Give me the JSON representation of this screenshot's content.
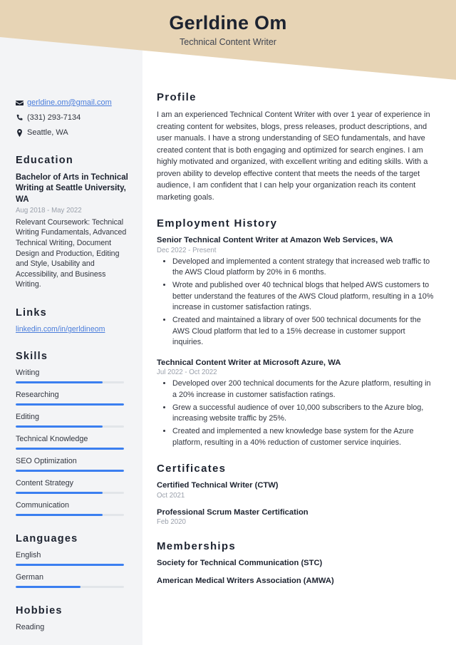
{
  "header": {
    "name": "Gerldine Om",
    "subtitle": "Technical Content Writer",
    "banner_color": "#e7d4b5"
  },
  "theme": {
    "accent": "#3b7ff0",
    "link": "#4a7ddb",
    "sidebar_bg": "#f3f4f6",
    "heading": "#1d2330",
    "muted": "#9aa0ab"
  },
  "sidebar": {
    "contact": [
      {
        "icon": "envelope-icon",
        "value": "gerldine.om@gmail.com",
        "is_link": true
      },
      {
        "icon": "phone-icon",
        "value": "(331) 293-7134",
        "is_link": false
      },
      {
        "icon": "map-pin-icon",
        "value": "Seattle, WA",
        "is_link": false
      }
    ],
    "education": {
      "heading": "Education",
      "entries": [
        {
          "title": "Bachelor of Arts in Technical Writing at Seattle University, WA",
          "date": "Aug 2018 - May 2022",
          "description": "Relevant Coursework: Technical Writing Fundamentals, Advanced Technical Writing, Document Design and Production, Editing and Style, Usability and Accessibility, and Business Writing."
        }
      ]
    },
    "links": {
      "heading": "Links",
      "items": [
        {
          "label": "linkedin.com/in/gerldineom"
        }
      ]
    },
    "skills": {
      "heading": "Skills",
      "items": [
        {
          "label": "Writing",
          "level": 80
        },
        {
          "label": "Researching",
          "level": 100
        },
        {
          "label": "Editing",
          "level": 80
        },
        {
          "label": "Technical Knowledge",
          "level": 100
        },
        {
          "label": "SEO Optimization",
          "level": 100
        },
        {
          "label": "Content Strategy",
          "level": 80
        },
        {
          "label": "Communication",
          "level": 80
        }
      ]
    },
    "languages": {
      "heading": "Languages",
      "items": [
        {
          "label": "English",
          "level": 100
        },
        {
          "label": "German",
          "level": 60
        }
      ]
    },
    "hobbies": {
      "heading": "Hobbies",
      "items": [
        {
          "label": "Reading"
        }
      ]
    }
  },
  "main": {
    "profile": {
      "heading": "Profile",
      "text": "I am an experienced Technical Content Writer with over 1 year of experience in creating content for websites, blogs, press releases, product descriptions, and user manuals. I have a strong understanding of SEO fundamentals, and have created content that is both engaging and optimized for search engines. I am highly motivated and organized, with excellent writing and editing skills. With a proven ability to develop effective content that meets the needs of the target audience, I am confident that I can help your organization reach its content marketing goals."
    },
    "employment": {
      "heading": "Employment History",
      "jobs": [
        {
          "title": "Senior Technical Content Writer at Amazon Web Services, WA",
          "date": "Dec 2022 - Present",
          "bullets": [
            "Developed and implemented a content strategy that increased web traffic to the AWS Cloud platform by 20% in 6 months.",
            "Wrote and published over 40 technical blogs that helped AWS customers to better understand the features of the AWS Cloud platform, resulting in a 10% increase in customer satisfaction ratings.",
            "Created and maintained a library of over 500 technical documents for the AWS Cloud platform that led to a 15% decrease in customer support inquiries."
          ]
        },
        {
          "title": "Technical Content Writer at Microsoft Azure, WA",
          "date": "Jul 2022 - Oct 2022",
          "bullets": [
            "Developed over 200 technical documents for the Azure platform, resulting in a 20% increase in customer satisfaction ratings.",
            "Grew a successful audience of over 10,000 subscribers to the Azure blog, increasing website traffic by 25%.",
            "Created and implemented a new knowledge base system for the Azure platform, resulting in a 40% reduction of customer service inquiries."
          ]
        }
      ]
    },
    "certificates": {
      "heading": "Certificates",
      "items": [
        {
          "title": "Certified Technical Writer (CTW)",
          "date": "Oct 2021"
        },
        {
          "title": "Professional Scrum Master Certification",
          "date": "Feb 2020"
        }
      ]
    },
    "memberships": {
      "heading": "Memberships",
      "items": [
        {
          "title": "Society for Technical Communication (STC)"
        },
        {
          "title": "American Medical Writers Association (AMWA)"
        }
      ]
    }
  }
}
